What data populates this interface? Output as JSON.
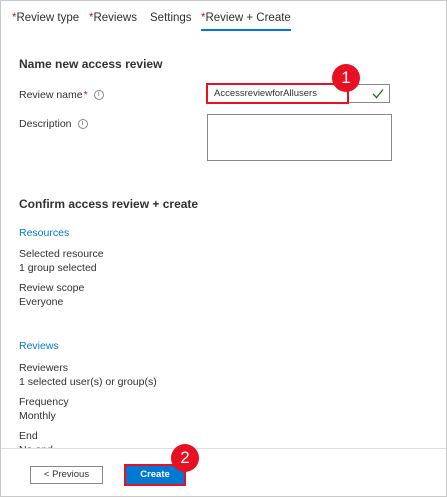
{
  "tabs": [
    {
      "label": "Review type",
      "required": true
    },
    {
      "label": "Reviews",
      "required": true
    },
    {
      "label": "Settings",
      "required": false
    },
    {
      "label": "Review + Create",
      "required": true,
      "active": true
    }
  ],
  "required_marker": "*",
  "name_section": {
    "title": "Name new access review",
    "review_name_label": "Review name",
    "review_name_value": "AccessreviewforAllusers",
    "description_label": "Description",
    "description_value": ""
  },
  "confirm_section": {
    "title": "Confirm access review + create",
    "resources_heading": "Resources",
    "selected_resource_label": "Selected resource",
    "selected_resource_value": "1 group selected",
    "review_scope_label": "Review scope",
    "review_scope_value": "Everyone",
    "reviews_heading": "Reviews",
    "reviewers_label": "Reviewers",
    "reviewers_value": "1 selected user(s) or group(s)",
    "frequency_label": "Frequency",
    "frequency_value": "Monthly",
    "end_label": "End",
    "end_value": "No end"
  },
  "footer": {
    "previous_label": "< Previous",
    "create_label": "Create"
  },
  "callouts": {
    "one": "1",
    "two": "2"
  },
  "icons": {
    "info": "info-icon",
    "check": "checkmark-icon"
  },
  "colors": {
    "accent": "#0078d4",
    "required": "#a4262c",
    "highlight": "#e81123",
    "valid": "#107c10"
  }
}
